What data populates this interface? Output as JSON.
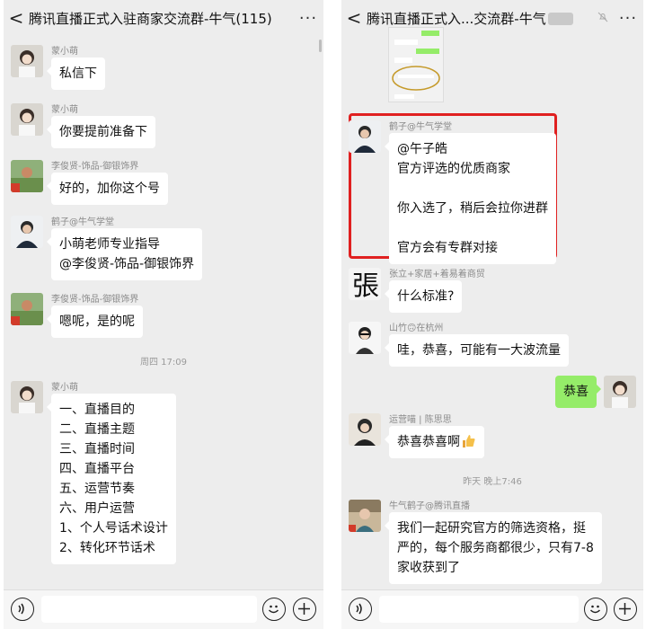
{
  "left": {
    "title": "腾讯直播正式入驻商家交流群-牛气(115)",
    "more": "···",
    "back": "<",
    "messages": [
      {
        "sender": "蒙小萌",
        "text": "私信下"
      },
      {
        "sender": "蒙小萌",
        "text": "你要提前准备下"
      },
      {
        "sender": "李俊贤-饰品-御银饰界",
        "text": "好的，加你这个号"
      },
      {
        "sender": "鹤子@牛气学堂",
        "text": "小萌老师专业指导\n@李俊贤-饰品-御银饰界"
      },
      {
        "sender": "李俊贤-饰品-御银饰界",
        "text": "嗯呢，是的呢"
      },
      {
        "sender": "蒙小萌",
        "text": "一、直播目的\n二、直播主题\n三、直播时间\n四、直播平台\n五、运营节奏\n六、用户运营\n1、个人号话术设计\n2、转化环节话术"
      }
    ],
    "timestamp": "周四 17:09"
  },
  "right": {
    "title": "腾讯直播正式入...交流群-牛气",
    "back": "<",
    "more": "···",
    "messages": [
      {
        "sender": "鹤子@牛气学堂",
        "text": "@午子皓\n官方评选的优质商家\n\n你入选了，稍后会拉你进群\n\n官方会有专群对接"
      },
      {
        "sender": "张立+家居+着易着商贸",
        "text": "什么标准?"
      },
      {
        "sender": "山竹🙃在杭州",
        "text": "哇，恭喜，可能有一大波流量"
      },
      {
        "sender": "",
        "text": "恭喜"
      },
      {
        "sender": "运营喵 | 陈思思",
        "text": "恭喜恭喜啊"
      },
      {
        "sender": "牛气鹤子@腾讯直播",
        "text": "我们一起研究官方的筛选资格，挺\n严的，每个服务商都很少，只有7-8\n家收获到了"
      }
    ],
    "timestamp": "昨天 晚上7:46"
  },
  "colors": {
    "background": "#ededed",
    "bubble_self": "#95ec69",
    "bubble_other": "#ffffff",
    "highlight": "#e02020"
  },
  "icons": [
    "back-icon",
    "more-icon",
    "voice-icon",
    "emoji-icon",
    "plus-icon",
    "mute-icon",
    "thumbs-up-icon"
  ]
}
